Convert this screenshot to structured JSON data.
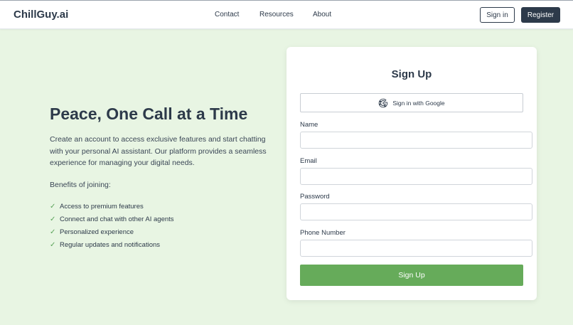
{
  "header": {
    "logo": "ChillGuy.ai",
    "nav": [
      "Contact",
      "Resources",
      "About"
    ],
    "signin_label": "Sign in",
    "register_label": "Register"
  },
  "hero": {
    "title": "Peace, One Call at a Time",
    "description": "Create an account to access exclusive features and start chatting with your personal AI assistant. Our platform provides a seamless experience for managing your digital needs.",
    "benefits_title": "Benefits of joining:",
    "check_glyph": "✓",
    "benefits": [
      "Access to premium features",
      "Connect and chat with other AI agents",
      "Personalized experience",
      "Regular updates and notifications"
    ]
  },
  "form": {
    "title": "Sign Up",
    "google_label": "Sign in with Google",
    "google_icon": "google-icon",
    "fields": [
      {
        "label": "Name",
        "value": "",
        "placeholder": ""
      },
      {
        "label": "Email",
        "value": "",
        "placeholder": ""
      },
      {
        "label": "Password",
        "value": "",
        "placeholder": ""
      },
      {
        "label": "Phone Number",
        "value": "",
        "placeholder": ""
      }
    ],
    "submit_label": "Sign Up"
  },
  "colors": {
    "background": "#e8f5e3",
    "primary_dark": "#2d3a4a",
    "accent_green": "#66ab5a"
  }
}
